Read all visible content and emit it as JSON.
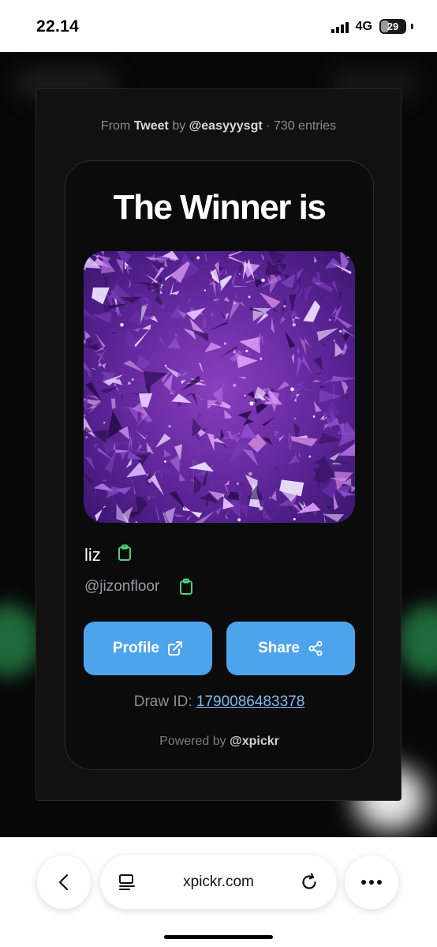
{
  "status_bar": {
    "time": "22.14",
    "network": "4G",
    "battery": "29",
    "battery_level": 0.29
  },
  "modal": {
    "source": {
      "prefix": "From",
      "platform": "Tweet",
      "by": "by",
      "author": "@easyyysgt",
      "separator": "·",
      "entries": "730 entries"
    },
    "title": "The Winner is",
    "winner": {
      "name": "liz",
      "handle": "@jizonfloor"
    },
    "buttons": {
      "profile_label": "Profile",
      "share_label": "Share"
    },
    "draw": {
      "label": "Draw ID:",
      "id": "1790086483378"
    },
    "powered": {
      "prefix": "Powered by",
      "brand": "@xpickr"
    }
  },
  "browser": {
    "url": "xpickr.com"
  },
  "colors": {
    "accent": "#4ea4ec",
    "copy_icon": "#4fd07a",
    "link": "#7fbcf0"
  },
  "icons": {
    "copy": "clipboard-icon",
    "profile": "external-link-icon",
    "share": "share-icon",
    "back": "chevron-left-icon",
    "reader": "reader-mode-icon",
    "reload": "reload-icon",
    "more": "more-icon"
  }
}
